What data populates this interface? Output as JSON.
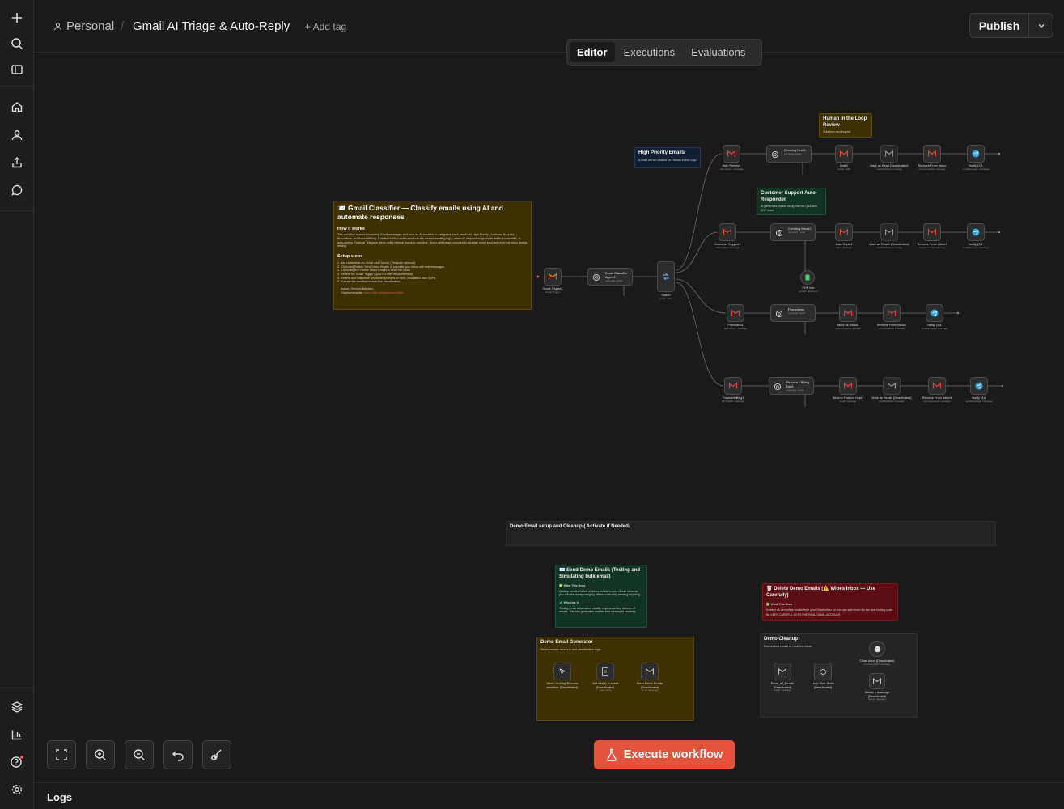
{
  "sidebar": {
    "top_icons": [
      "plus-icon",
      "search-icon",
      "panel-toggle-icon",
      "home-icon",
      "user-icon",
      "share-icon",
      "chat-icon"
    ],
    "bottom_icons": [
      "layers-icon",
      "insights-icon",
      "help-icon",
      "settings-icon"
    ]
  },
  "header": {
    "project": "Personal",
    "separator": "/",
    "workflow_title": "Gmail AI Triage & Auto-Reply",
    "add_tag": "+ Add tag",
    "publish": "Publish"
  },
  "tabs": [
    {
      "label": "Editor",
      "active": true
    },
    {
      "label": "Executions",
      "active": false
    },
    {
      "label": "Evaluations",
      "active": false
    }
  ],
  "stickies": {
    "main": {
      "title": "📨 Gmail Classifier — Classify emails using AI and automate responses",
      "how_heading": "How it works",
      "how_text": "This workflow monitors incoming Gmail messages and uses an AI classifier to categorize each email into High Priority, Customer Support, Promotions, or Finance/Billing. A central switch routes emails to the correct handling logic, where AI responders generate drafts, summaries, or auto-replies. Optional Telegram alerts notify internal teams in real-time. Demo utilities are included to simulate email load and reset the inbox during testing.",
      "setup_heading": "Setup steps",
      "setup_steps": [
        "1. Add credentials for Gmail and OpenAI (Telegram optional).",
        "2. (Optional) Enable Send Demo Emails to populate your inbox with test messages.",
        "3. (Optional) Run Delete Demo Emails to reset the inbox.",
        "4. Review the Gmail Trigger (Q6MTx0 filter recommended).",
        "5. Review and customize responder prompts for tone, escalation, and SOPs.",
        "6. Activate the workflow to start live classification."
      ],
      "author": "Author: Servicer Bahador",
      "template_label": "Original template:",
      "template_link": "https://n8n.io/workflows/10086"
    },
    "human_loop": {
      "title": "Human in the Loop Review",
      "text": "• Mailbox sending out"
    },
    "high_priority": {
      "title": "High Priority Emails",
      "text": "A Draft will be created for Human in the Loop"
    },
    "customer_support": {
      "title": "Customer Support Auto-Responder",
      "text": "AI generates replies using internal Q&A and SOP docs."
    },
    "demo_setup": {
      "title": "Demo Email setup and Cleanup ( Activate if Needed)"
    },
    "send_demo": {
      "title": "📧 Send Demo Emails (Testing and Simulating bulk email)",
      "h1": "✅ What This Does",
      "t1": "Quickly sends a batch of demo emails to your Gmail inbox so you can test every category without manually sending anything.",
      "h2": "🧪 Why Use It",
      "t2": "Testing email automation usually requires writing dozens of emails. This tool generates realistic test messages instantly."
    },
    "delete_demo": {
      "title": "🗑 Delete Demo Emails (⚠️ Wipes Inbox — Use Carefully)",
      "h1": "✅ What This Does",
      "t1": "Deletes all demo/test emails from your Gmail inbox so you can start fresh for the next testing cycle.",
      "t2": "Be VERY CAREFUL WITH THE REAL GMAIL ACCOUNT."
    },
    "demo_generator": {
      "title": "Demo Email Generator",
      "text": "Sends sample emails to test classification logic."
    },
    "demo_cleanup": {
      "title": "Demo Cleanup",
      "text": "Deletes test emails to reset the inbox."
    }
  },
  "nodes": {
    "trigger": {
      "label": "Gmail Trigger1",
      "sub": "Gmail Trigger"
    },
    "classifier": {
      "label": "Email Classifier Agent1",
      "sub": "message model"
    },
    "switch": {
      "label": "Switch",
      "sub": "mode: rules"
    },
    "r1": [
      {
        "label": "High Priority1",
        "sub": "add: labels: message"
      },
      {
        "label": "Creating Draft1",
        "sub": "message model"
      },
      {
        "label": "Draft1",
        "sub": "create: draft"
      },
      {
        "label": "Mark as Read (Deactivated)",
        "sub": "markAsRead: message"
      },
      {
        "label": "Remove From Inbox",
        "sub": "removeLabels: message"
      },
      {
        "label": "Notify (1)1",
        "sub": "sendMessage: message"
      }
    ],
    "r2": [
      {
        "label": "Customer Support1",
        "sub": "add: labels: message"
      },
      {
        "label": "Creating Email1",
        "sub": "message model"
      },
      {
        "label": "Auto Reply1",
        "sub": "reply: message"
      },
      {
        "label": "Mark as Read1 (Deactivated)",
        "sub": "markAsRead: message"
      },
      {
        "label": "Remove From Inbox1",
        "sub": "removeLabels: message"
      },
      {
        "label": "Notify (2)1",
        "sub": "sendMessage: message"
      }
    ],
    "pdf_info": {
      "label": "PDF Info",
      "sub": "extract: document"
    },
    "r3": [
      {
        "label": "Promotion1",
        "sub": "add: labels: message"
      },
      {
        "label": "Promotions",
        "sub": "message model"
      },
      {
        "label": "Mark as Read2",
        "sub": "markAsRead: message"
      },
      {
        "label": "Remove From Inbox2",
        "sub": "removeLabels: message"
      },
      {
        "label": "Notify (3)1",
        "sub": "sendMessage: message"
      }
    ],
    "r4": [
      {
        "label": "Finance/Billing1",
        "sub": "add: labels: message"
      },
      {
        "label": "Finance / Billing Dept",
        "sub": "message model"
      },
      {
        "label": "Send to Finance Dept1",
        "sub": "send: message"
      },
      {
        "label": "Mark as Read3 (Deactivated)",
        "sub": "markAsRead: message"
      },
      {
        "label": "Remove From Inbox3",
        "sub": "removeLabels: message"
      },
      {
        "label": "Notify (4)1",
        "sub": "sendMessage: message"
      }
    ],
    "gen": [
      {
        "label": "When clicking 'Execute workflow' (Deactivated)",
        "sub": ""
      },
      {
        "label": "Get row(s) in sheet (Deactivated)",
        "sub": "read: sheet"
      },
      {
        "label": "Send Demo Emails (Deactivated)",
        "sub": "send: message"
      }
    ],
    "cleanup": [
      {
        "label": "Read_all_Emails (Deactivated)",
        "sub": "getAll: message"
      },
      {
        "label": "Loop Over Items (Deactivated)",
        "sub": ""
      },
      {
        "label": "Clear Inbox (Deactivated)",
        "sub": "removeLabels: message"
      },
      {
        "label": "Delete a message (Deactivated)",
        "sub": "delete: message"
      }
    ]
  },
  "controls": [
    "fit-view-icon",
    "zoom-in-icon",
    "zoom-out-icon",
    "undo-icon",
    "tidy-up-icon"
  ],
  "execute_label": "Execute workflow",
  "logs_label": "Logs",
  "colors": {
    "accent": "#e5533c",
    "sticky_yellow": "#3d3100",
    "sticky_green": "#133323",
    "sticky_red": "#5c0e14",
    "sticky_blue": "#121f30",
    "gmail_red": "#ea4335",
    "telegram_blue": "#2aa3df"
  }
}
